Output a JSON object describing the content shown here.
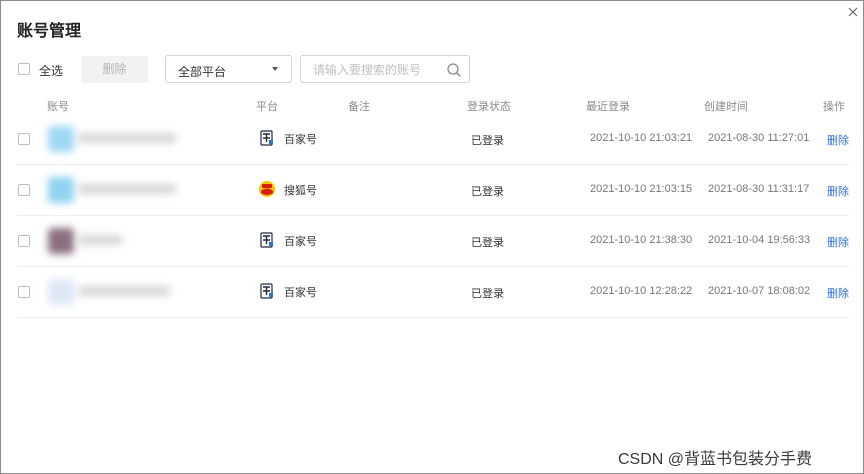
{
  "dialog": {
    "title": "账号管理",
    "close_icon": "close-icon"
  },
  "toolbar": {
    "select_all_label": "全选",
    "select_all_checked": false,
    "delete_label": "删除",
    "platform_select": {
      "value": "全部平台"
    },
    "search": {
      "value": "",
      "placeholder": "请输入要搜索的账号",
      "icon": "search-icon"
    }
  },
  "table": {
    "headers": {
      "account": "账号",
      "platform": "平台",
      "remark": "备注",
      "status": "登录状态",
      "last_login": "最近登录",
      "created": "创建时间",
      "action": "操作"
    },
    "rows": [
      {
        "checked": false,
        "account_blurred": true,
        "avatar_color": "#9fd8f5",
        "platform": "百家号",
        "platform_icon": "baijiahao-icon",
        "remark": "",
        "status": "已登录",
        "last_login": "2021-10-10 21:03:21",
        "created": "2021-08-30 11:27:01",
        "action": "删除"
      },
      {
        "checked": false,
        "account_blurred": true,
        "avatar_color": "#8fd3f0",
        "platform": "搜狐号",
        "platform_icon": "sohu-icon",
        "remark": "",
        "status": "已登录",
        "last_login": "2021-10-10 21:03:15",
        "created": "2021-08-30 11:31:17",
        "action": "删除"
      },
      {
        "checked": false,
        "account_blurred": true,
        "avatar_color": "#8a6f80",
        "platform": "百家号",
        "platform_icon": "baijiahao-icon",
        "remark": "",
        "status": "已登录",
        "last_login": "2021-10-10 21:38:30",
        "created": "2021-10-04 19:56:33",
        "action": "删除"
      },
      {
        "checked": false,
        "account_blurred": true,
        "avatar_color": "#dfe7f7",
        "platform": "百家号",
        "platform_icon": "baijiahao-icon",
        "remark": "",
        "status": "已登录",
        "last_login": "2021-10-10 12:28:22",
        "created": "2021-10-07 18:08:02",
        "action": "删除"
      }
    ]
  },
  "watermark": "CSDN @背蓝书包装分手费",
  "colors": {
    "link": "#2f6fe0",
    "sohu_yellow": "#f5c400",
    "sohu_red": "#d81e06"
  }
}
